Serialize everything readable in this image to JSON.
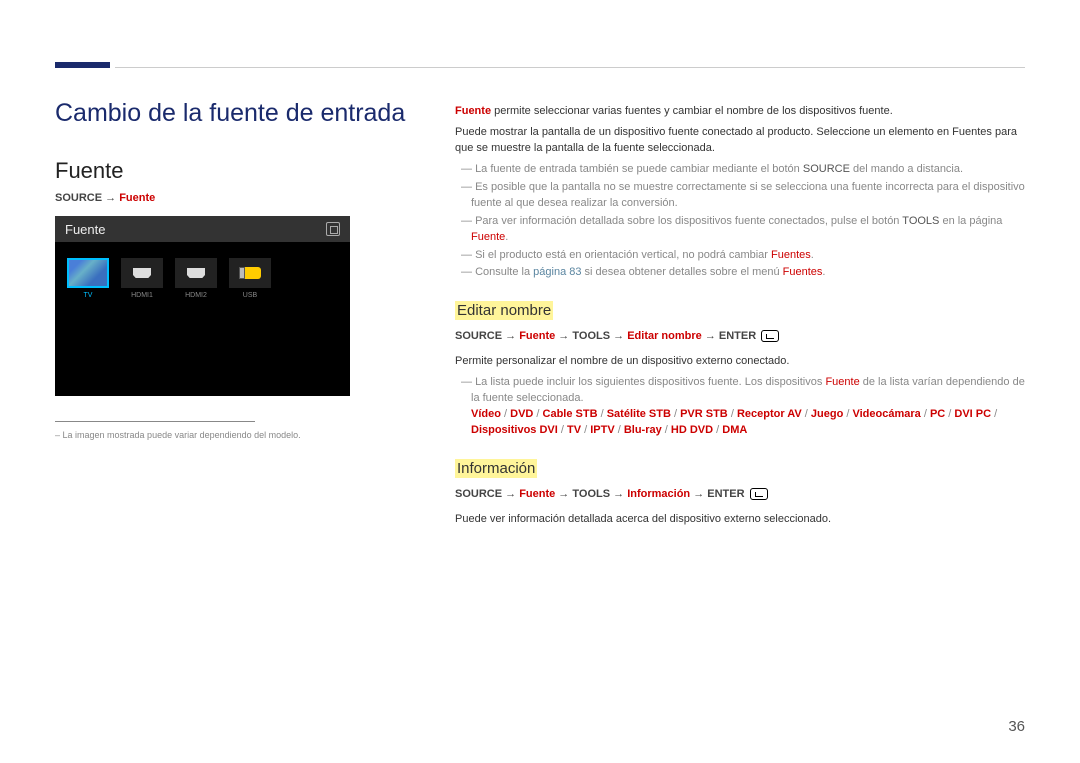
{
  "page_number": "36",
  "title": "Cambio de la fuente de entrada",
  "left": {
    "heading": "Fuente",
    "nav": {
      "source": "SOURCE",
      "arrow": " → ",
      "fuente": "Fuente"
    },
    "screenshot": {
      "title": "Fuente",
      "items": [
        {
          "label": "TV",
          "active": true
        },
        {
          "label": "HDMI1"
        },
        {
          "label": "HDMI2"
        },
        {
          "label": "USB"
        }
      ]
    },
    "footnote_prefix": "–  ",
    "footnote": "La imagen mostrada puede variar dependiendo del modelo."
  },
  "right": {
    "intro": {
      "line1_a": "Fuente",
      "line1_b": " permite seleccionar varias fuentes y cambiar el nombre de los dispositivos fuente.",
      "line2": "Puede mostrar la pantalla de un dispositivo fuente conectado al producto. Seleccione un elemento en Fuentes para que se muestre la pantalla de la fuente seleccionada."
    },
    "notes1": {
      "n1_a": "La fuente de entrada también se puede cambiar mediante el botón ",
      "n1_b": "SOURCE",
      "n1_c": " del mando a distancia.",
      "n2": "Es posible que la pantalla no se muestre correctamente si se selecciona una fuente incorrecta para el dispositivo fuente al que desea realizar la conversión.",
      "n3_a": "Para ver información detallada sobre los dispositivos fuente conectados, pulse el botón ",
      "n3_b": "TOOLS",
      "n3_c": " en la página ",
      "n3_d": "Fuente",
      "n3_e": ".",
      "n4_a": "Si el producto está en orientación vertical, no podrá cambiar ",
      "n4_b": "Fuentes",
      "n4_c": ".",
      "n5_a": "Consulte la ",
      "n5_b": "página 83",
      "n5_c": " si desea obtener detalles sobre el menú ",
      "n5_d": "Fuentes",
      "n5_e": "."
    },
    "section_edit": {
      "heading": "Editar nombre",
      "nav": {
        "p1": "SOURCE",
        "a": " → ",
        "p2": "Fuente",
        "p3": "TOOLS",
        "p4": "Editar nombre",
        "p5": "ENTER"
      },
      "body": "Permite personalizar el nombre de un dispositivo externo conectado.",
      "note_a": "La lista puede incluir los siguientes dispositivos fuente. Los dispositivos ",
      "note_b": "Fuente",
      "note_c": " de la lista varían dependiendo de la fuente seleccionada.",
      "devices": [
        "Vídeo",
        "DVD",
        "Cable STB",
        "Satélite STB",
        "PVR STB",
        "Receptor AV",
        "Juego",
        "Videocámara",
        "PC",
        "DVI PC",
        "Dispositivos DVI",
        "TV",
        "IPTV",
        "Blu-ray",
        "HD DVD",
        "DMA"
      ],
      "sep": " / "
    },
    "section_info": {
      "heading": "Información",
      "nav": {
        "p1": "SOURCE",
        "a": " → ",
        "p2": "Fuente",
        "p3": "TOOLS",
        "p4": "Información",
        "p5": "ENTER"
      },
      "body": "Puede ver información detallada acerca del dispositivo externo seleccionado."
    }
  }
}
